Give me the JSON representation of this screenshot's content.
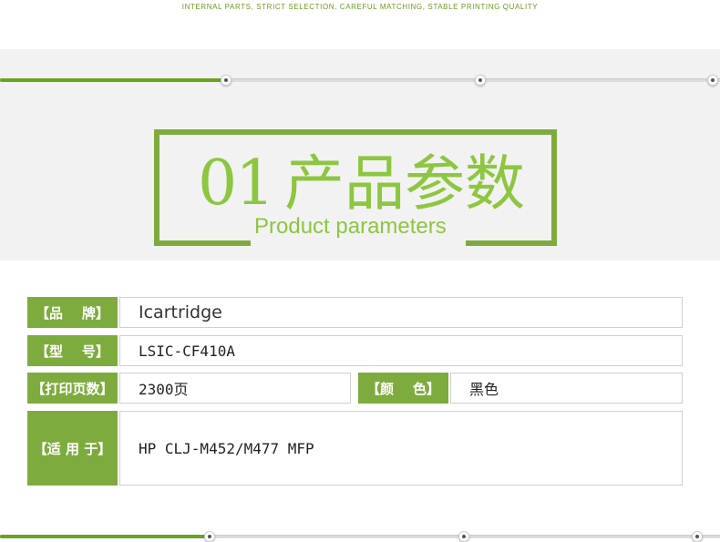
{
  "header": {
    "tagline": "INTERNAL PARTS, STRICT SELECTION, CAREFUL MATCHING, STABLE PRINTING QUALITY"
  },
  "progress": {
    "filled_fraction": 0.31,
    "step_count": 3
  },
  "section": {
    "number": "01",
    "title_zh": "产品参数",
    "title_en": "Product parameters"
  },
  "params": {
    "brand": {
      "label": "【品    牌】",
      "value": "Icartridge"
    },
    "model": {
      "label": "【型    号】",
      "value": "LSIC-CF410A"
    },
    "pages": {
      "label": "【打印页数】",
      "value": "2300页"
    },
    "color": {
      "label": "【颜    色】",
      "value": "黑色"
    },
    "fits": {
      "label": "【适 用 于】",
      "value": "HP CLJ-M452/M477 MFP"
    }
  },
  "colors": {
    "accent": "#7eab3e",
    "title_green": "#8dc63f",
    "track_fill": "#6aa31d"
  }
}
